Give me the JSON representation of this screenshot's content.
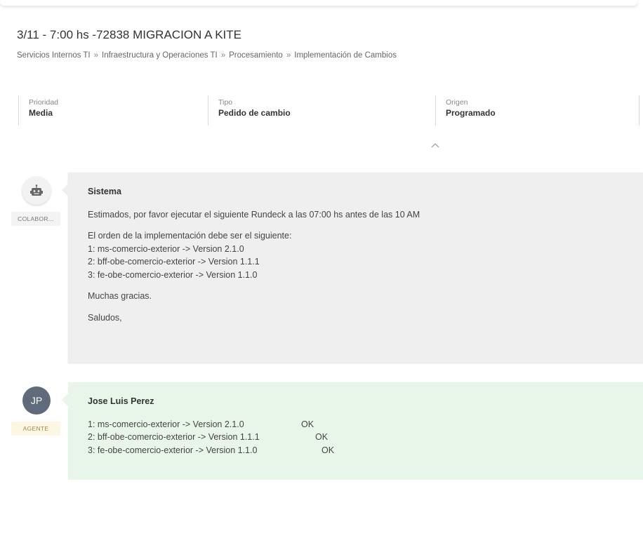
{
  "ticket": {
    "title": "3/11 - 7:00 hs -72838 MIGRACION A KITE",
    "breadcrumb": [
      "Servicios Internos TI",
      "Infraestructura y Operaciones TI",
      "Procesamiento",
      "Implementación de Cambios"
    ],
    "breadcrumb_separator": "»"
  },
  "meta": {
    "priority": {
      "label": "Prioridad",
      "value": "Media"
    },
    "type": {
      "label": "Tipo",
      "value": "Pedido de cambio"
    },
    "origin": {
      "label": "Origen",
      "value": "Programado"
    }
  },
  "icons": {
    "collapse": "chevron-up-icon",
    "system_avatar": "robot-icon"
  },
  "messages": [
    {
      "author": "Sistema",
      "role_badge": "COLABOR...",
      "avatar_icon": "robot-icon",
      "paragraphs": [
        "Estimados, por favor ejecutar el siguiente Rundeck a las 07:00 hs antes de las 10 AM"
      ],
      "order_intro": "El orden de la implementación debe ser el siguiente:",
      "order_lines": [
        "1: ms-comercio-exterior -> Version 2.1.0",
        "2: bff-obe-comercio-exterior -> Version 1.1.1",
        "3: fe-obe-comercio-exterior -> Version 1.1.0"
      ],
      "thanks": "Muchas gracias.",
      "closing": "Saludos,"
    },
    {
      "author": "Jose Luis Perez",
      "role_badge": "AGENTE",
      "avatar_initials": "JP",
      "lines": [
        {
          "text": "1: ms-comercio-exterior -> Version 2.1.0",
          "status": "OK"
        },
        {
          "text": "2: bff-obe-comercio-exterior -> Version 1.1.1",
          "status": "OK"
        },
        {
          "text": "3: fe-obe-comercio-exterior -> Version 1.1.0",
          "status": "OK"
        }
      ]
    }
  ],
  "colors": {
    "system_bubble": "#efefef",
    "agent_bubble": "#e8f6ea",
    "agent_avatar": "#5f6b7a",
    "agent_badge_bg": "#fdf6e3"
  }
}
